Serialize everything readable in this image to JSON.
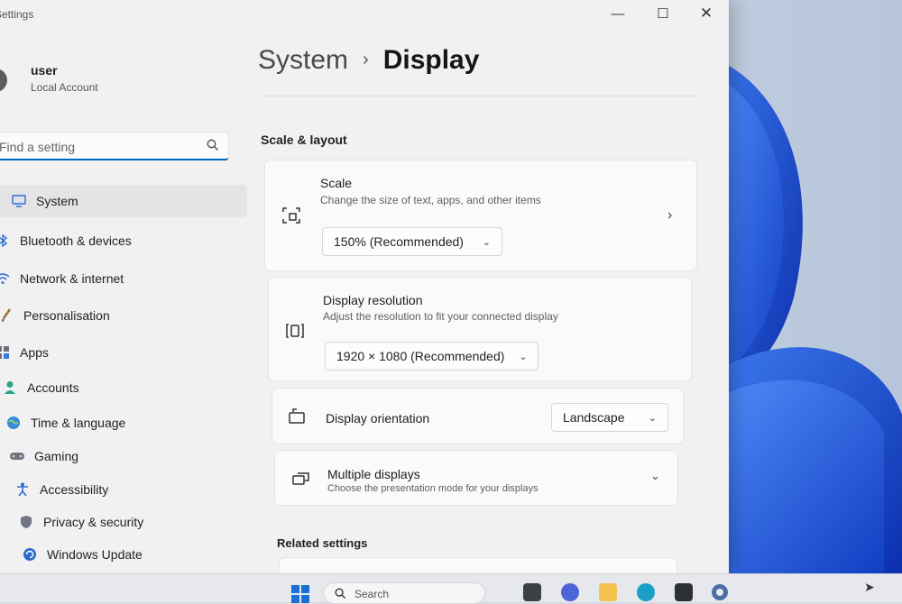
{
  "window": {
    "app_title": "Settings"
  },
  "controls": {
    "minimize": "—",
    "maximize": "☐",
    "close": "✕"
  },
  "user": {
    "name": "user",
    "account_type": "Local Account"
  },
  "search": {
    "placeholder": "Find a setting"
  },
  "sidebar": {
    "items": [
      {
        "label": "System",
        "icon": "monitor-icon",
        "active": true
      },
      {
        "label": "Bluetooth & devices",
        "icon": "bluetooth-icon"
      },
      {
        "label": "Network & internet",
        "icon": "wifi-icon"
      },
      {
        "label": "Personalisation",
        "icon": "brush-icon"
      },
      {
        "label": "Apps",
        "icon": "apps-icon"
      },
      {
        "label": "Accounts",
        "icon": "person-icon"
      },
      {
        "label": "Time & language",
        "icon": "globe-icon"
      },
      {
        "label": "Gaming",
        "icon": "gamepad-icon"
      },
      {
        "label": "Accessibility",
        "icon": "accessibility-icon"
      },
      {
        "label": "Privacy & security",
        "icon": "shield-icon"
      },
      {
        "label": "Windows Update",
        "icon": "update-icon"
      }
    ]
  },
  "breadcrumb": {
    "parent": "System",
    "separator": "›",
    "current": "Display"
  },
  "main": {
    "section_title": "Scale & layout",
    "scale": {
      "title": "Scale",
      "description": "Change the size of text, apps, and other items",
      "value": "150% (Recommended)"
    },
    "resolution": {
      "title": "Display resolution",
      "description": "Adjust the resolution to fit your connected display",
      "value": "1920 × 1080 (Recommended)"
    },
    "orientation": {
      "title": "Display orientation",
      "value": "Landscape"
    },
    "multiple": {
      "title": "Multiple displays",
      "description": "Choose the presentation mode for your displays"
    },
    "related_title": "Related settings"
  },
  "taskbar": {
    "search_label": "Search"
  },
  "colors": {
    "accent": "#0067c0",
    "window_bg": "#f1f1f1",
    "card_bg": "#fafafa",
    "wallpaper_blue": "#1450d8"
  }
}
